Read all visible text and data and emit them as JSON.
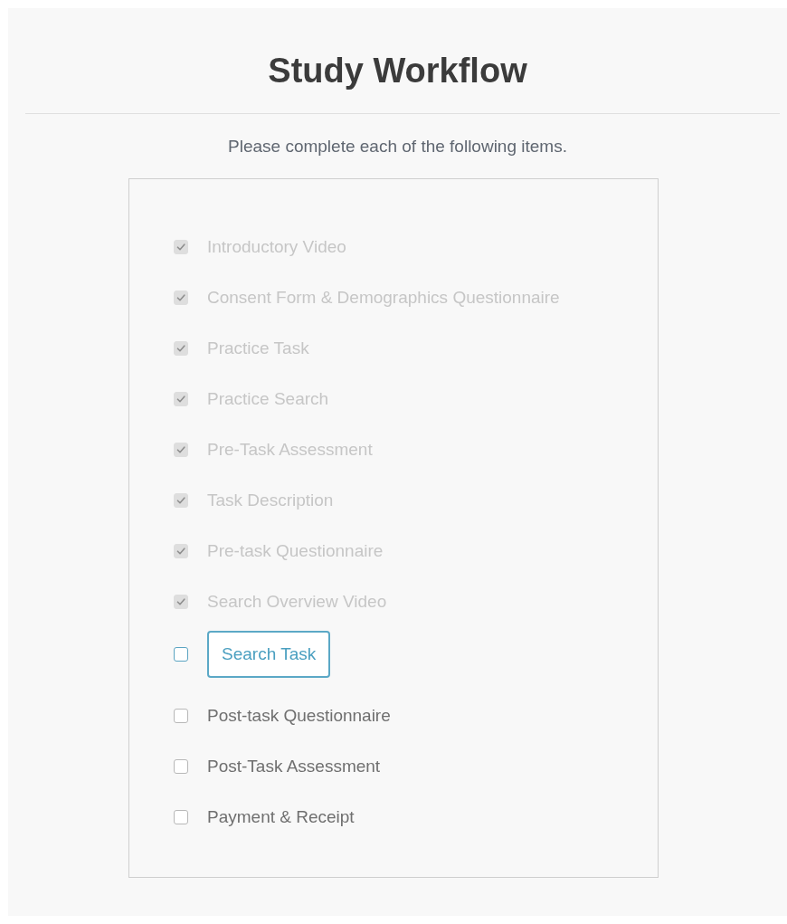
{
  "title": "Study Workflow",
  "instructions": "Please complete each of the following items.",
  "items": [
    {
      "label": "Introductory Video",
      "checked": true,
      "current": false
    },
    {
      "label": "Consent Form & Demographics Questionnaire",
      "checked": true,
      "current": false
    },
    {
      "label": "Practice Task",
      "checked": true,
      "current": false
    },
    {
      "label": "Practice Search",
      "checked": true,
      "current": false
    },
    {
      "label": "Pre-Task Assessment",
      "checked": true,
      "current": false
    },
    {
      "label": "Task Description",
      "checked": true,
      "current": false
    },
    {
      "label": "Pre-task Questionnaire",
      "checked": true,
      "current": false
    },
    {
      "label": "Search Overview Video",
      "checked": true,
      "current": false
    },
    {
      "label": "Search Task",
      "checked": false,
      "current": true
    },
    {
      "label": "Post-task Questionnaire",
      "checked": false,
      "current": false
    },
    {
      "label": "Post-Task Assessment",
      "checked": false,
      "current": false
    },
    {
      "label": "Payment & Receipt",
      "checked": false,
      "current": false
    }
  ]
}
